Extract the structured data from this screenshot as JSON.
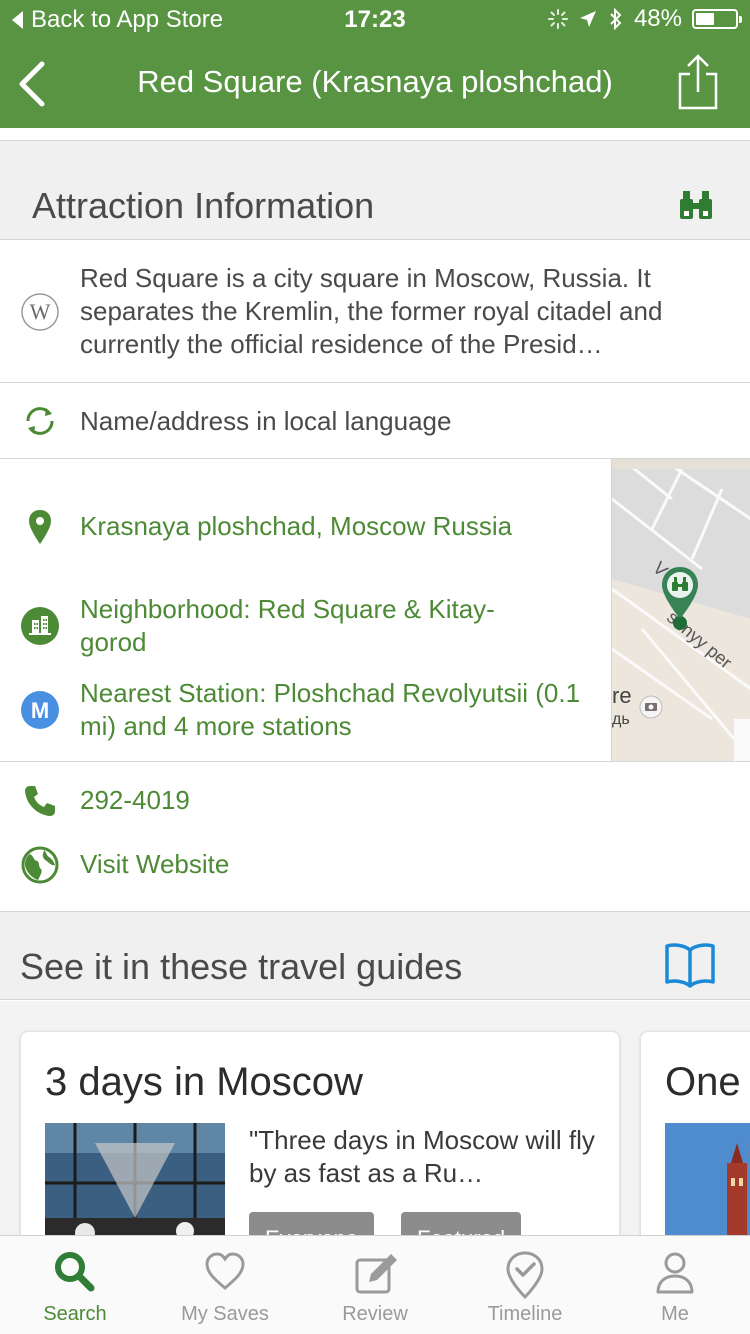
{
  "status_bar": {
    "back_label": "Back to App Store",
    "time": "17:23",
    "battery": "48%",
    "battery_level": 0.48
  },
  "nav": {
    "title": "Red Square (Krasnaya ploshchad)"
  },
  "attraction_info": {
    "heading": "Attraction Information",
    "description": "Red Square is a city square in Moscow, Russia. It separates the Kremlin, the former royal citadel and currently the official residence of the Presid…",
    "local_language_label": "Name/address in local language",
    "address": "Krasnaya ploshchad, Moscow Russia",
    "neighborhood": "Neighborhood: Red Square & Kitay-gorod",
    "station_badge": "M",
    "nearest_station": "Nearest Station: Ploshchad Revolyutsii (0.1 mi) and 4 more stations",
    "map_labels": {
      "street": "shnyy per",
      "street_prefix": "V",
      "fragment_1": "re",
      "fragment_2": "дь"
    },
    "phone": "292-4019",
    "website": "Visit Website"
  },
  "guides": {
    "heading": "See it in these travel guides",
    "cards": [
      {
        "title": "3 days in Moscow",
        "quote": "\"Three days in Moscow will fly by as fast as a Ru…",
        "tags": [
          "Everyone",
          "Featured"
        ]
      },
      {
        "title": "One"
      }
    ]
  },
  "tabbar": {
    "tabs": [
      {
        "label": "Search",
        "icon": "search-icon",
        "active": true
      },
      {
        "label": "My Saves",
        "icon": "heart-icon",
        "active": false
      },
      {
        "label": "Review",
        "icon": "edit-icon",
        "active": false
      },
      {
        "label": "Timeline",
        "icon": "location-check-icon",
        "active": false
      },
      {
        "label": "Me",
        "icon": "person-icon",
        "active": false
      }
    ]
  },
  "colors": {
    "brand_green": "#589442",
    "link_green": "#4d8a35",
    "guide_blue": "#1a8ad6",
    "metro_blue": "#4a90e2"
  }
}
